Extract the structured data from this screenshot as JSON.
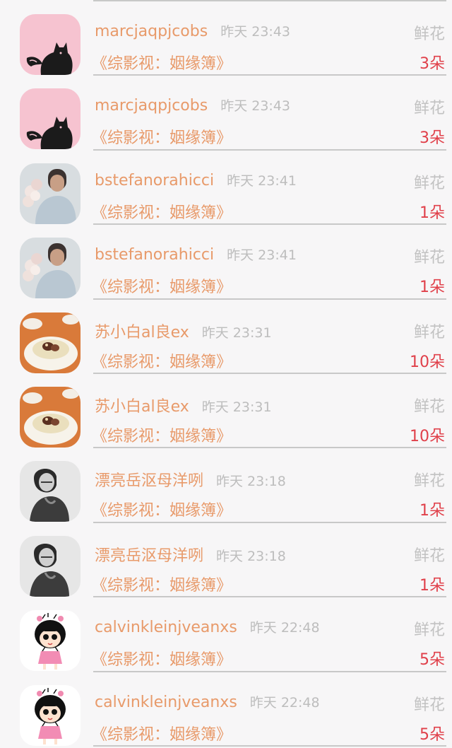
{
  "rows": [
    {
      "username": "marcjaqpjcobs",
      "time": "昨天 23:43",
      "gift_label": "鲜花",
      "book_title": "《综影视：姻缘簿》",
      "count": "3朵",
      "avatar": "cat-silhouette-icon"
    },
    {
      "username": "marcjaqpjcobs",
      "time": "昨天 23:43",
      "gift_label": "鲜花",
      "book_title": "《综影视：姻缘簿》",
      "count": "3朵",
      "avatar": "cat-silhouette-icon"
    },
    {
      "username": "bstefanorahicci",
      "time": "昨天 23:41",
      "gift_label": "鲜花",
      "book_title": "《综影视：姻缘簿》",
      "count": "1朵",
      "avatar": "man-with-flowers-photo"
    },
    {
      "username": "bstefanorahicci",
      "time": "昨天 23:41",
      "gift_label": "鲜花",
      "book_title": "《综影视：姻缘簿》",
      "count": "1朵",
      "avatar": "man-with-flowers-photo"
    },
    {
      "username": "苏小白al良ex",
      "time": "昨天 23:31",
      "gift_label": "鲜花",
      "book_title": "《综影视：姻缘簿》",
      "count": "10朵",
      "avatar": "dessert-bowl-photo"
    },
    {
      "username": "苏小白al良ex",
      "time": "昨天 23:31",
      "gift_label": "鲜花",
      "book_title": "《综影视：姻缘簿》",
      "count": "10朵",
      "avatar": "dessert-bowl-photo"
    },
    {
      "username": "漂亮岳沤母洋咧",
      "time": "昨天 23:18",
      "gift_label": "鲜花",
      "book_title": "《综影视：姻缘簿》",
      "count": "1朵",
      "avatar": "bw-portrait-photo"
    },
    {
      "username": "漂亮岳沤母洋咧",
      "time": "昨天 23:18",
      "gift_label": "鲜花",
      "book_title": "《综影视：姻缘簿》",
      "count": "1朵",
      "avatar": "bw-portrait-photo"
    },
    {
      "username": "calvinkleinjveanxs",
      "time": "昨天 22:48",
      "gift_label": "鲜花",
      "book_title": "《综影视：姻缘簿》",
      "count": "5朵",
      "avatar": "cartoon-girl-icon"
    },
    {
      "username": "calvinkleinjveanxs",
      "time": "昨天 22:48",
      "gift_label": "鲜花",
      "book_title": "《综影视：姻缘簿》",
      "count": "5朵",
      "avatar": "cartoon-girl-icon"
    }
  ],
  "colors": {
    "username": "#e89a6a",
    "time": "#bdbdbd",
    "gift_label": "#c2c2c2",
    "count": "#e0404a",
    "separator": "#c8c8c8",
    "background": "#f7f6f7"
  }
}
